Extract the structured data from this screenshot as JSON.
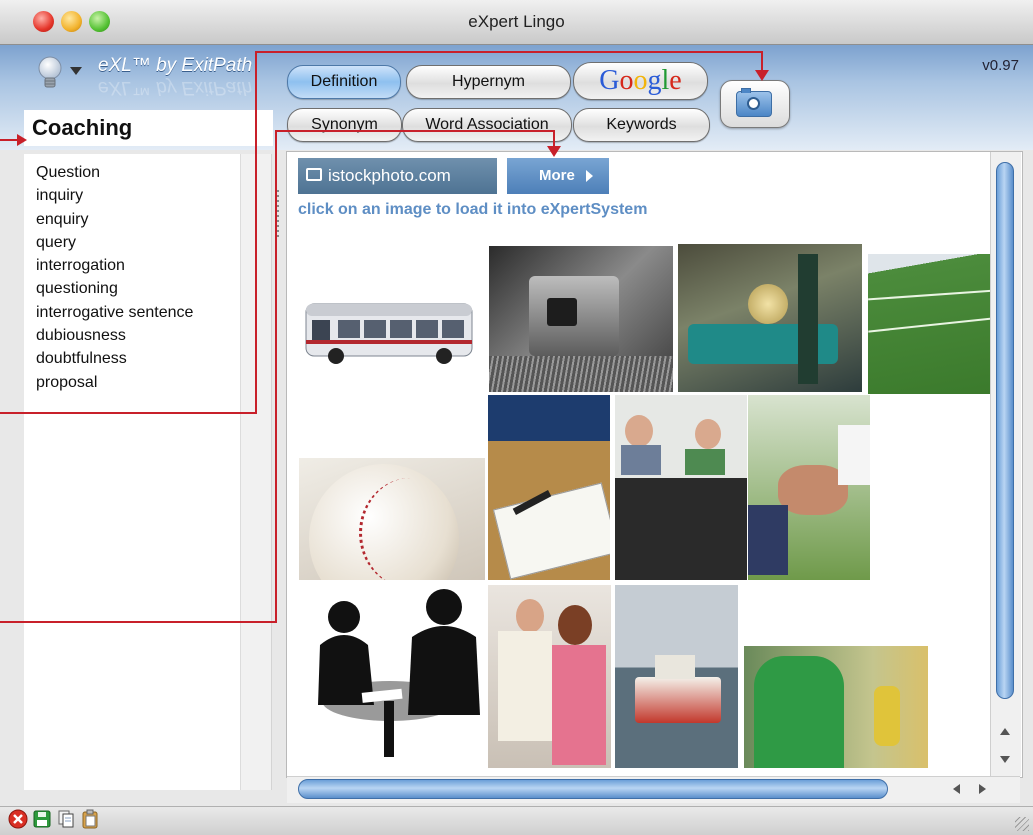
{
  "window": {
    "title": "eXpert Lingo",
    "brand": "eXL™ by ExitPath",
    "version": "v0.97"
  },
  "toolbar": {
    "tabs": [
      {
        "label": "Definition",
        "active": true
      },
      {
        "label": "Hypernym",
        "active": false
      },
      {
        "label": "Synonym",
        "active": false
      },
      {
        "label": "Word Association",
        "active": false
      },
      {
        "label": "Keywords",
        "active": false
      }
    ],
    "google": [
      "G",
      "o",
      "o",
      "g",
      "l",
      "e"
    ],
    "google_colors": [
      "#2a5bd7",
      "#d6281b",
      "#f2b40a",
      "#2a5bd7",
      "#1f9a33",
      "#d6281b"
    ],
    "camera_icon": "camera-icon"
  },
  "sidebar": {
    "word": "Coaching",
    "synonyms": [
      "Question",
      "inquiry",
      "enquiry",
      "query",
      "interrogation",
      "questioning",
      "interrogative sentence",
      "dubiousness",
      "doubtfulness",
      "proposal"
    ]
  },
  "content": {
    "istock_label": "istockphoto.com",
    "more_label": "More",
    "hint": "click on an image to load it into eXpertSystem",
    "images": [
      "bus",
      "old machine",
      "cart",
      "football field",
      "baseball",
      "gym whiteboard",
      "children at computer",
      "hands together",
      "meeting silhouette",
      "teacher and student",
      "ferry",
      "coach"
    ]
  },
  "footer": {
    "icons": [
      "delete-icon",
      "save-icon",
      "copy-icon",
      "paste-icon"
    ]
  },
  "colors": {
    "annotation": "#c8202a",
    "accent": "#5e8ec4"
  }
}
